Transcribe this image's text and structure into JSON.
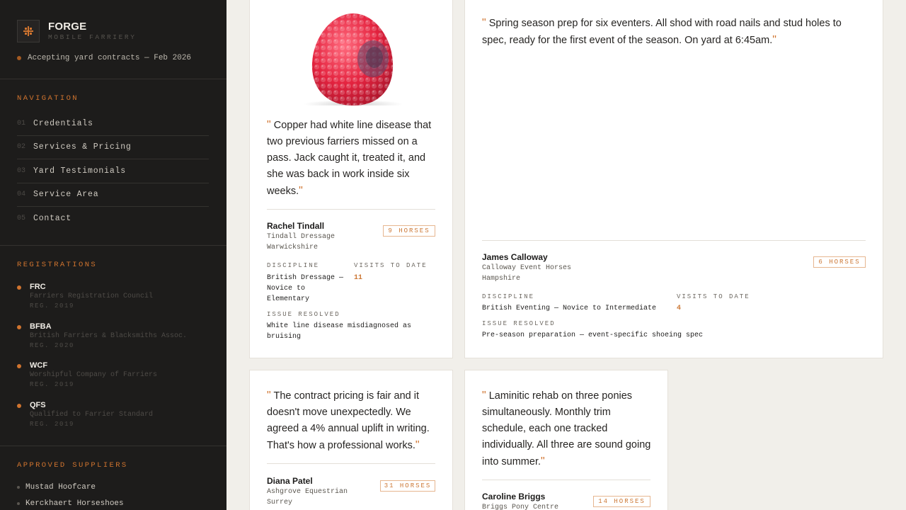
{
  "brand": {
    "title": "FORGE",
    "subtitle": "MOBILE FARRIERY",
    "logo_icon": "forge-logo-icon",
    "accent": "#d0742f"
  },
  "status": {
    "text": "Accepting yard contracts — Feb 2026"
  },
  "navigation": {
    "title": "NAVIGATION",
    "items": [
      {
        "num": "01",
        "label": "Credentials"
      },
      {
        "num": "02",
        "label": "Services & Pricing"
      },
      {
        "num": "03",
        "label": "Yard Testimonials"
      },
      {
        "num": "04",
        "label": "Service Area"
      },
      {
        "num": "05",
        "label": "Contact"
      }
    ]
  },
  "registrations": {
    "title": "REGISTRATIONS",
    "items": [
      {
        "code": "FRC",
        "name": "Farriers Registration Council",
        "year": "REG. 2019"
      },
      {
        "code": "BFBA",
        "name": "British Farriers & Blacksmiths Assoc.",
        "year": "REG. 2020"
      },
      {
        "code": "WCF",
        "name": "Worshipful Company of Farriers",
        "year": "REG. 2019"
      },
      {
        "code": "QFS",
        "name": "Qualified to Farrier Standard",
        "year": "REG. 2019"
      }
    ]
  },
  "suppliers": {
    "title": "APPROVED SUPPLIERS",
    "items": [
      "Mustad Hoofcare",
      "Kerckhaert Horseshoes"
    ]
  },
  "testimonials": [
    {
      "quote": "Copper had white line disease that two previous farriers missed on a pass. Jack caught it, treated it, and she was back in work inside six weeks.",
      "name": "Rachel Tindall",
      "yard": "Tindall Dressage",
      "county": "Warwickshire",
      "horses": "9 HORSES",
      "discipline_label": "DISCIPLINE",
      "discipline": "British Dressage — Novice to Elementary",
      "visits_label": "VISITS TO DATE",
      "visits": "11",
      "issue_label": "ISSUE RESOLVED",
      "issue": "White line disease misdiagnosed as bruising"
    },
    {
      "quote": "Spring season prep for six eventers. All shod with road nails and stud holes to spec, ready for the first event of the season. On yard at 6:45am.",
      "name": "James Calloway",
      "yard": "Calloway Event Horses",
      "county": "Hampshire",
      "horses": "6 HORSES",
      "discipline_label": "DISCIPLINE",
      "discipline": "British Eventing — Novice to Intermediate",
      "visits_label": "VISITS TO DATE",
      "visits": "4",
      "issue_label": "ISSUE RESOLVED",
      "issue": "Pre-season preparation — event-specific shoeing spec"
    },
    {
      "quote": "The contract pricing is fair and it doesn't move unexpectedly. We agreed a 4% annual uplift in writing. That's how a professional works.",
      "name": "Diana Patel",
      "yard": "Ashgrove Equestrian",
      "county": "Surrey",
      "horses": "31 HORSES"
    },
    {
      "quote": "Laminitic rehab on three ponies simultaneously. Monthly trim schedule, each one tracked individually. All three are sound going into summer.",
      "name": "Caroline Briggs",
      "yard": "Briggs Pony Centre",
      "horses": "14 HORSES"
    }
  ]
}
